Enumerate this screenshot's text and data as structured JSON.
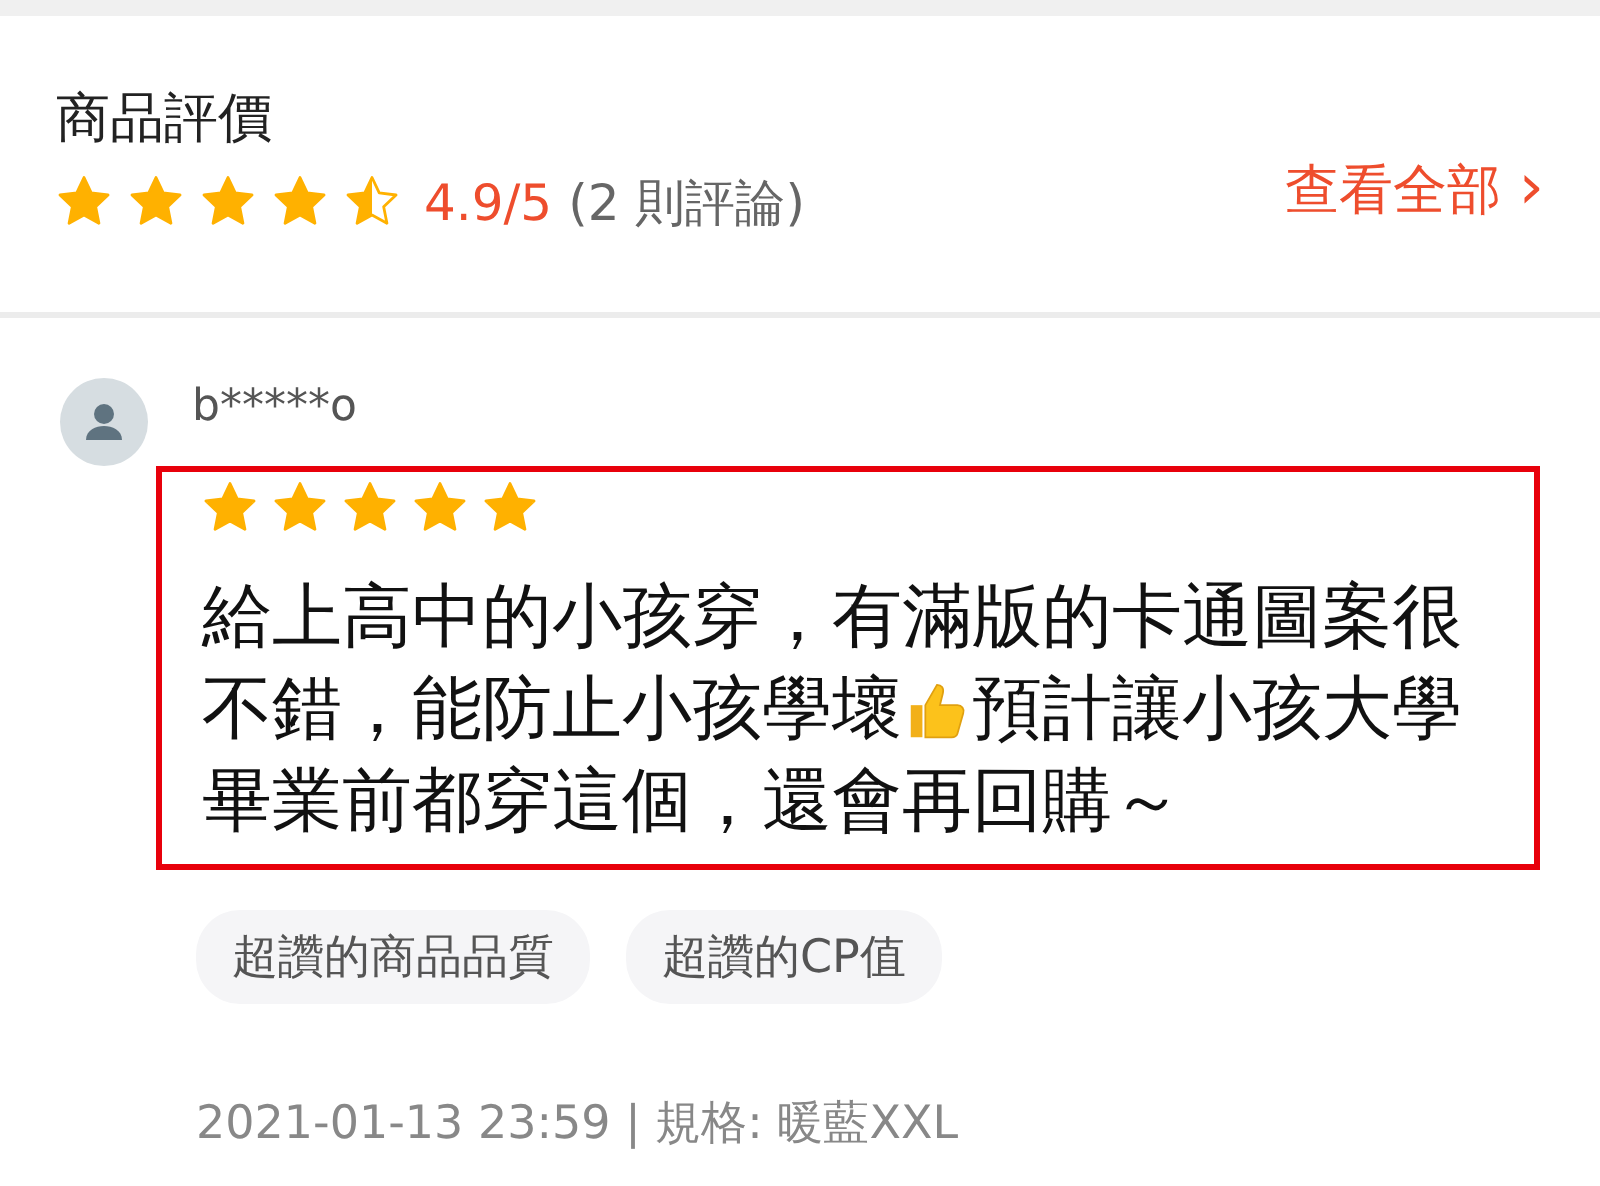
{
  "header": {
    "title": "商品評價",
    "stars": 4.5,
    "score": "4.9/5",
    "count": "(2 則評論)",
    "view_all": "查看全部",
    "chevron": "›"
  },
  "review": {
    "user": "b*****o",
    "stars": 5,
    "highlighted": true,
    "lines": [
      [
        {
          "kind": "text",
          "text": "給上高中的小孩穿，有滿版的卡通圖案很"
        }
      ],
      [
        {
          "kind": "text",
          "text": "不錯，能防止小孩學壞"
        },
        {
          "kind": "thumbs_up"
        },
        {
          "kind": "text",
          "text": "預計讓小孩大學"
        }
      ],
      [
        {
          "kind": "text",
          "text": "畢業前都穿這個，還會再回購～"
        }
      ]
    ],
    "tags": [
      "超讚的商品品質",
      "超讚的CP值"
    ],
    "meta": "2021-01-13 23:59 | 規格: 暖藍XXL"
  }
}
